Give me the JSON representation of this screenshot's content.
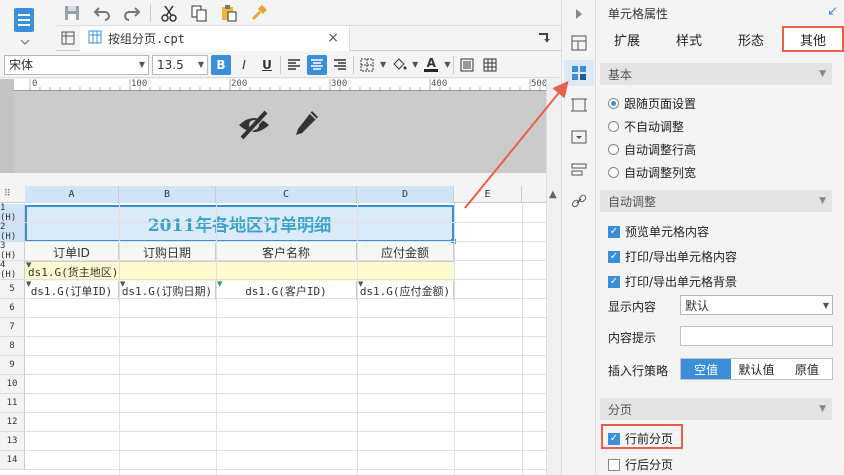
{
  "tab": {
    "label": "按组分页.cpt",
    "close": "×"
  },
  "format": {
    "font_name": "宋体",
    "font_size": "13.5",
    "bold": "B",
    "italic": "I",
    "underline": "U",
    "font_color_glyph": "A"
  },
  "ruler": {
    "marks": [
      "0",
      "100",
      "200",
      "300",
      "400",
      "500"
    ]
  },
  "grid": {
    "columns": [
      "A",
      "B",
      "C",
      "D",
      "E"
    ],
    "rows": [
      "1 (H)",
      "2 (H)",
      "3 (H)",
      "4 (H)",
      "5",
      "6",
      "7",
      "8",
      "9",
      "10",
      "11",
      "12",
      "13",
      "14"
    ],
    "title": "2011年各地区订单明细",
    "headers": [
      "订单ID",
      "订购日期",
      "客户名称",
      "应付金额"
    ],
    "group": "ds1.G(货主地区)",
    "data": [
      "ds1.G(订单ID)",
      "ds1.G(订购日期)",
      "ds1.G(客户ID)",
      "ds1.G(应付金额)"
    ]
  },
  "panel": {
    "title": "单元格属性",
    "tabs": [
      "扩展",
      "样式",
      "形态",
      "其他"
    ],
    "active_tab": "其他",
    "sections": {
      "basic": {
        "title": "基本",
        "options": [
          "跟随页面设置",
          "不自动调整",
          "自动调整行高",
          "自动调整列宽"
        ],
        "selected": "跟随页面设置"
      },
      "auto": {
        "title": "自动调整",
        "checks": [
          "预览单元格内容",
          "打印/导出单元格内容",
          "打印/导出单元格背景"
        ],
        "display_label": "显示内容",
        "display_value": "默认",
        "tip_label": "内容提示",
        "tip_value": "",
        "insert_label": "插入行策略",
        "insert_options": [
          "空值",
          "默认值",
          "原值"
        ],
        "insert_selected": "空值"
      },
      "page": {
        "title": "分页",
        "break_before": "行前分页",
        "break_after": "行后分页",
        "break_before_checked": true,
        "break_after_checked": false
      }
    }
  },
  "colors": {
    "accent": "#3b8fd9",
    "highlight": "#e8604c",
    "title_text": "#3aa3c9"
  }
}
